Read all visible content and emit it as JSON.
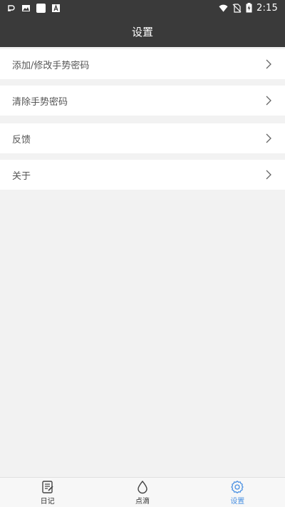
{
  "status_bar": {
    "time": "2:15",
    "left_icons": [
      "notification-icon",
      "image-icon",
      "square-icon",
      "font-icon"
    ],
    "right_icons": [
      "wifi-icon",
      "no-sim-icon",
      "battery-charging-icon"
    ]
  },
  "toolbar": {
    "title": "设置"
  },
  "settings": {
    "items": [
      {
        "label": "添加/修改手势密码"
      },
      {
        "label": "清除手势密码"
      },
      {
        "label": "反馈"
      },
      {
        "label": "关于"
      }
    ]
  },
  "tabbar": {
    "tabs": [
      {
        "label": "日记",
        "icon": "diary-icon",
        "active": false
      },
      {
        "label": "点滴",
        "icon": "drop-icon",
        "active": false
      },
      {
        "label": "设置",
        "icon": "gear-icon",
        "active": true
      }
    ],
    "active_color": "#4a90e2"
  },
  "colors": {
    "header_bg": "#3a3a3a",
    "page_bg": "#f2f2f2",
    "row_bg": "#ffffff"
  }
}
